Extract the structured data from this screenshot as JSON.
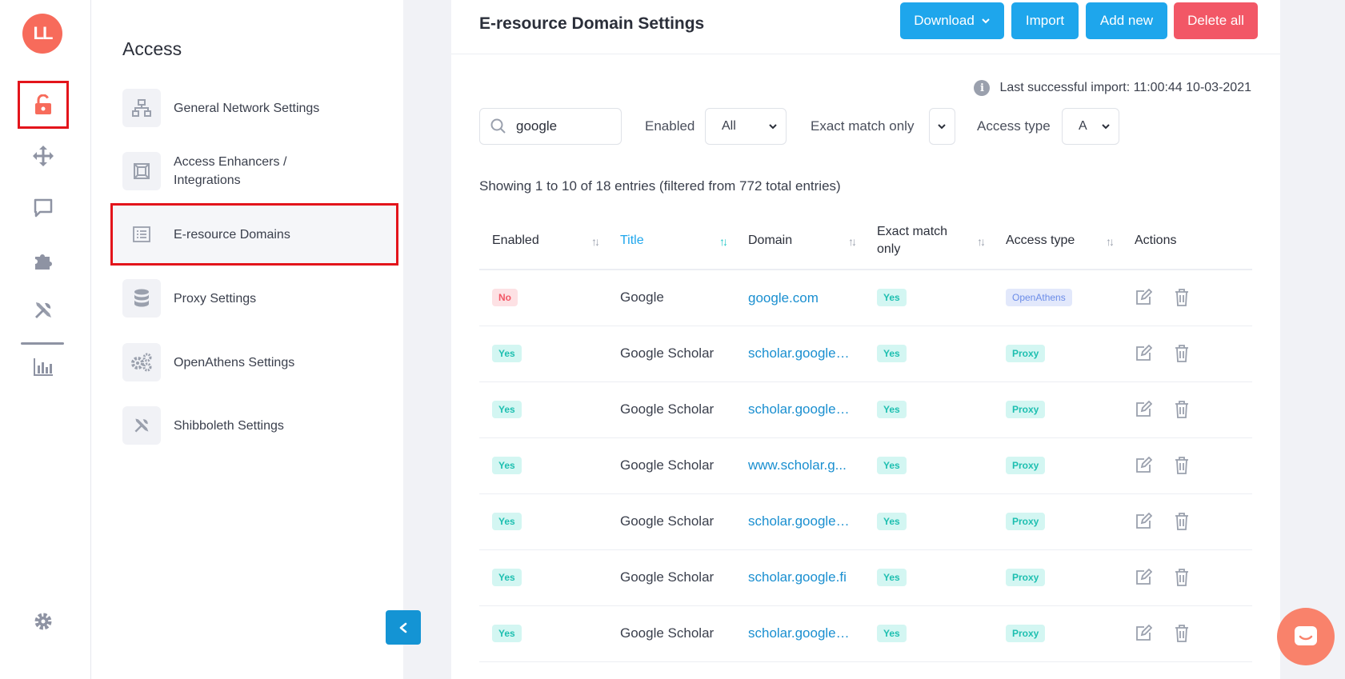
{
  "rail": {
    "logo_text": "LL",
    "icons": [
      "unlock-icon",
      "move-icon",
      "chat-icon",
      "puzzle-icon",
      "tools-icon",
      "bar-chart-icon",
      "gear-icon"
    ],
    "accent": "#f76b5b"
  },
  "sidebar": {
    "title": "Access",
    "items": [
      {
        "label": "General Network Settings",
        "icon": "network-icon"
      },
      {
        "label": "Access Enhancers / Integrations",
        "icon": "frame-icon"
      },
      {
        "label": "E-resource Domains",
        "icon": "list-icon",
        "active": true
      },
      {
        "label": "Proxy Settings",
        "icon": "database-icon"
      },
      {
        "label": "OpenAthens Settings",
        "icon": "gears-icon"
      },
      {
        "label": "Shibboleth Settings",
        "icon": "tools-icon"
      }
    ]
  },
  "main": {
    "title": "E-resource Domain Settings",
    "buttons": {
      "download": "Download",
      "import": "Import",
      "add_new": "Add new",
      "delete_all": "Delete all"
    },
    "last_import": "Last successful import: 11:00:44 10-03-2021",
    "search_value": "google",
    "filters": {
      "enabled_label": "Enabled",
      "enabled_value": "All",
      "exact_label": "Exact match only",
      "exact_value": "",
      "access_label": "Access type",
      "access_value": "A"
    },
    "entries_text": "Showing 1 to 10 of 18 entries (filtered from 772 total entries)"
  },
  "table": {
    "headers": {
      "enabled": "Enabled",
      "title": "Title",
      "domain": "Domain",
      "exact": "Exact match only",
      "access": "Access type",
      "actions": "Actions"
    },
    "rows": [
      {
        "enabled": "No",
        "title": "Google",
        "domain": "google.com",
        "exact": "Yes",
        "access": "OpenAthens"
      },
      {
        "enabled": "Yes",
        "title": "Google Scholar",
        "domain": "scholar.google....",
        "exact": "Yes",
        "access": "Proxy"
      },
      {
        "enabled": "Yes",
        "title": "Google Scholar",
        "domain": "scholar.google....",
        "exact": "Yes",
        "access": "Proxy"
      },
      {
        "enabled": "Yes",
        "title": "Google Scholar",
        "domain": "www.scholar.g...",
        "exact": "Yes",
        "access": "Proxy"
      },
      {
        "enabled": "Yes",
        "title": "Google Scholar",
        "domain": "scholar.google....",
        "exact": "Yes",
        "access": "Proxy"
      },
      {
        "enabled": "Yes",
        "title": "Google Scholar",
        "domain": "scholar.google.fi",
        "exact": "Yes",
        "access": "Proxy"
      },
      {
        "enabled": "Yes",
        "title": "Google Scholar",
        "domain": "scholar.google....",
        "exact": "Yes",
        "access": "Proxy"
      }
    ]
  }
}
